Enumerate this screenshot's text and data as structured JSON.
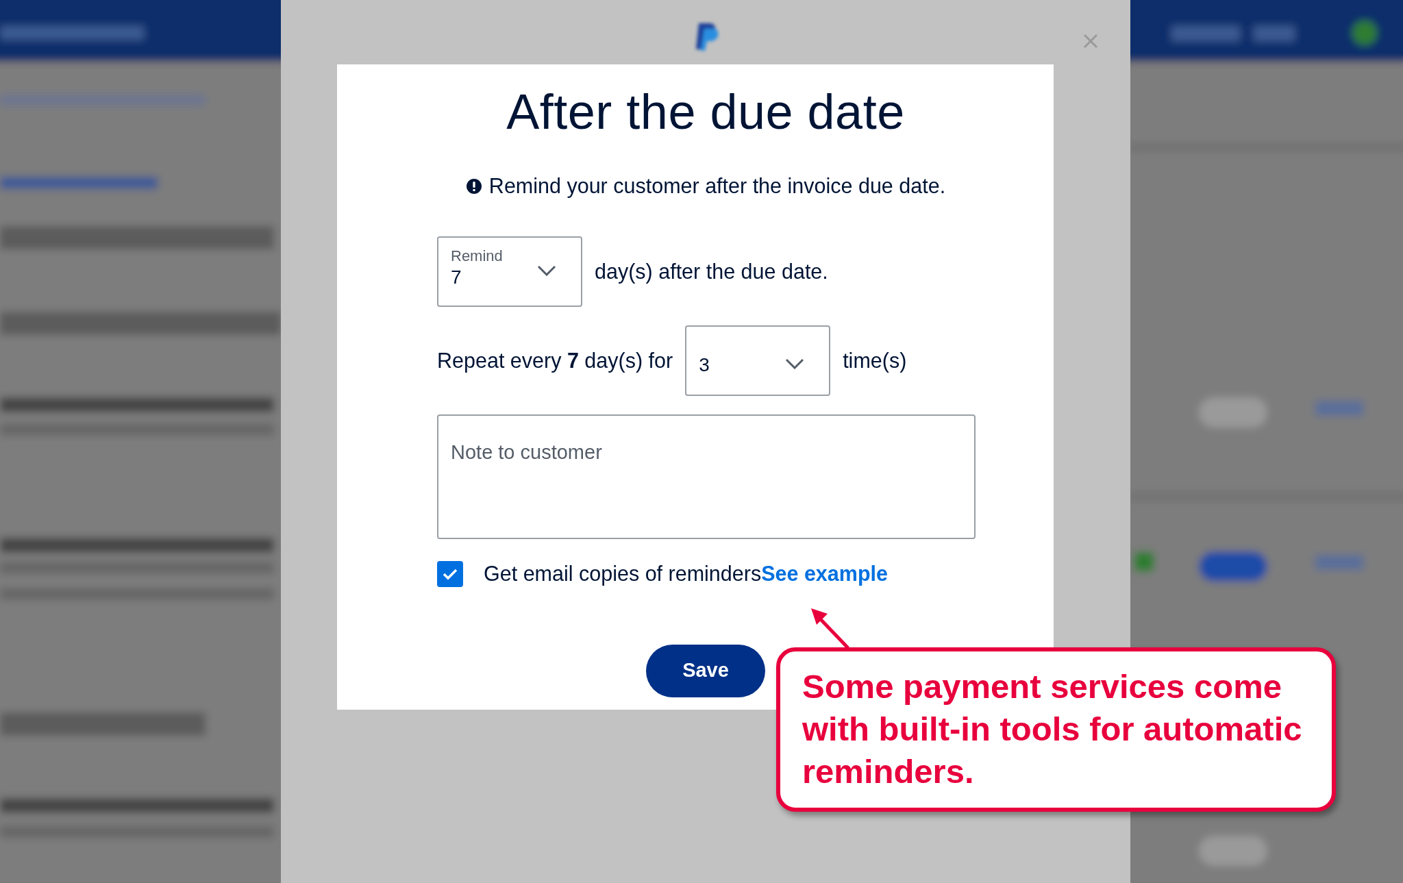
{
  "modal": {
    "title": "After the due date",
    "info": "Remind your customer after the invoice due date.",
    "remind_select": {
      "label": "Remind",
      "value": "7"
    },
    "remind_suffix": "day(s) after the due date.",
    "repeat_prefix": "Repeat every **7** day(s) for",
    "repeat_select": {
      "value": "3"
    },
    "repeat_suffix": "time(s)",
    "note": {
      "placeholder": "Note to customer"
    },
    "email_copies": {
      "label": "Get email copies of reminders",
      "checked": true,
      "link": "See example"
    },
    "save_button": "Save"
  },
  "callout": {
    "text": "Some payment services come with built-in tools for automatic reminders."
  }
}
